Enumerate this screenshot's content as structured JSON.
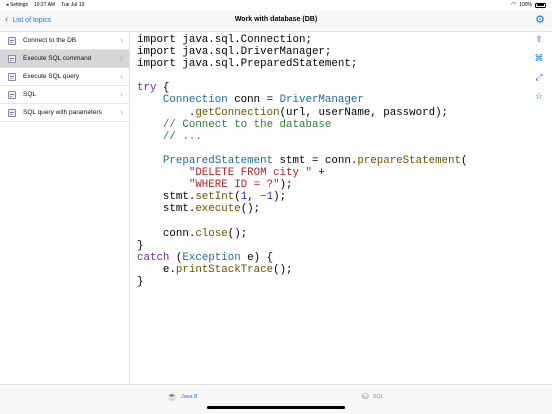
{
  "status": {
    "back_app": "◂ Settings",
    "time": "10:27 AM",
    "date": "Tue Jul 13",
    "battery_pct": "100%"
  },
  "nav": {
    "back_label": "List of topics",
    "title": "Work with database (DB)"
  },
  "sidebar": {
    "items": [
      {
        "label": "Connect to the DB"
      },
      {
        "label": "Execute SQL command"
      },
      {
        "label": "Execute SQL query"
      },
      {
        "label": "SQL"
      },
      {
        "label": "SQL query with parameters"
      }
    ]
  },
  "toolbar_icons": [
    "share-icon",
    "code-icon",
    "fullscreen-icon",
    "favorite-star-icon"
  ],
  "code": {
    "lines": [
      [
        {
          "t": "import java.sql.Connection;",
          "c": ""
        }
      ],
      [
        {
          "t": "import java.sql.DriverManager;",
          "c": ""
        }
      ],
      [
        {
          "t": "import java.sql.PreparedStatement;",
          "c": ""
        }
      ],
      [
        {
          "t": "",
          "c": ""
        }
      ],
      [
        {
          "t": "try",
          "c": "kw"
        },
        {
          "t": " {",
          "c": ""
        }
      ],
      [
        {
          "t": "    ",
          "c": ""
        },
        {
          "t": "Connection",
          "c": "ty"
        },
        {
          "t": " conn = ",
          "c": ""
        },
        {
          "t": "DriverManager",
          "c": "ty"
        }
      ],
      [
        {
          "t": "        .",
          "c": ""
        },
        {
          "t": "getConnection",
          "c": "mt"
        },
        {
          "t": "(url, userName, password);",
          "c": ""
        }
      ],
      [
        {
          "t": "    // Connect to the database",
          "c": "cm"
        }
      ],
      [
        {
          "t": "    // ...",
          "c": "cm"
        }
      ],
      [
        {
          "t": "",
          "c": ""
        }
      ],
      [
        {
          "t": "    ",
          "c": ""
        },
        {
          "t": "PreparedStatement",
          "c": "ty"
        },
        {
          "t": " stmt = conn.",
          "c": ""
        },
        {
          "t": "prepareStatement",
          "c": "mt"
        },
        {
          "t": "(",
          "c": ""
        }
      ],
      [
        {
          "t": "        ",
          "c": ""
        },
        {
          "t": "\"DELETE FROM city \"",
          "c": "st"
        },
        {
          "t": " +",
          "c": ""
        }
      ],
      [
        {
          "t": "        ",
          "c": ""
        },
        {
          "t": "\"WHERE ID = ?\"",
          "c": "st"
        },
        {
          "t": ");",
          "c": ""
        }
      ],
      [
        {
          "t": "    stmt.",
          "c": ""
        },
        {
          "t": "setInt",
          "c": "mt"
        },
        {
          "t": "(",
          "c": ""
        },
        {
          "t": "1",
          "c": "nm"
        },
        {
          "t": ", ",
          "c": ""
        },
        {
          "t": "−1",
          "c": "nm"
        },
        {
          "t": ");",
          "c": ""
        }
      ],
      [
        {
          "t": "    stmt.",
          "c": ""
        },
        {
          "t": "execute",
          "c": "mt"
        },
        {
          "t": "();",
          "c": ""
        }
      ],
      [
        {
          "t": "",
          "c": ""
        }
      ],
      [
        {
          "t": "    conn.",
          "c": ""
        },
        {
          "t": "close",
          "c": "mt"
        },
        {
          "t": "();",
          "c": ""
        }
      ],
      [
        {
          "t": "}",
          "c": ""
        }
      ],
      [
        {
          "t": "catch",
          "c": "kw"
        },
        {
          "t": " (",
          "c": ""
        },
        {
          "t": "Exception",
          "c": "ty"
        },
        {
          "t": " e) {",
          "c": ""
        }
      ],
      [
        {
          "t": "    e.",
          "c": ""
        },
        {
          "t": "printStackTrace",
          "c": "mt"
        },
        {
          "t": "();",
          "c": ""
        }
      ],
      [
        {
          "t": "}",
          "c": ""
        }
      ]
    ]
  },
  "tabs": [
    {
      "label": "Java 8",
      "icon": "java-cup-icon",
      "active": true
    },
    {
      "label": "SQL",
      "icon": "database-icon",
      "active": false
    }
  ],
  "colors": {
    "accent": "#1a73e8",
    "selected_row": "#d6d6d8",
    "keyword": "#7b2a8c",
    "type": "#1f6a9a",
    "comment": "#2d7d2d",
    "string": "#b32323",
    "method": "#6a5200",
    "number": "#1c34c6"
  }
}
